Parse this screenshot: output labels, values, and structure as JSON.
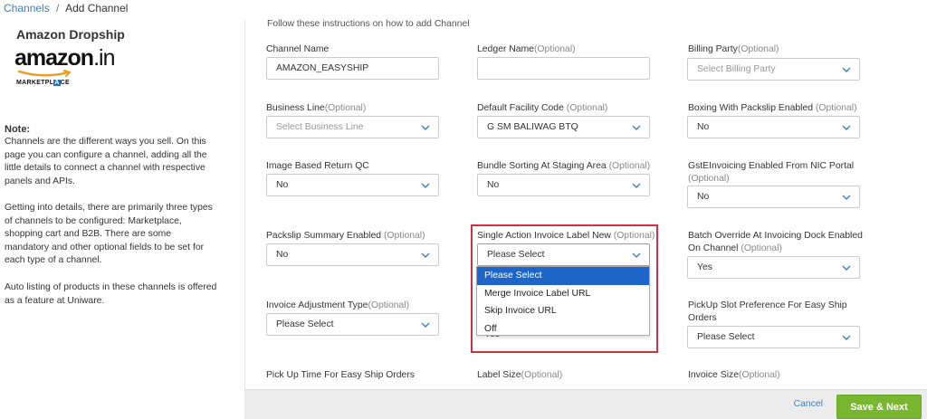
{
  "breadcrumb": {
    "parent": "Channels",
    "separator": "/",
    "current": "Add Channel"
  },
  "channel": {
    "title": "Amazon Dropship",
    "logo": {
      "main": "amazon",
      "suffix": ".in",
      "sub_before": "MARKETPL",
      "sub_highlight": "A",
      "sub_after": "CE"
    }
  },
  "note": {
    "title": "Note:",
    "paragraphs": [
      "Channels are the different ways you sell. On this page you can configure a channel, adding all the little details to connect a channel with respective panels and APIs.",
      "Getting into details, there are primarily three types of channels to be configured: Marketplace, shopping cart and B2B. There are some mandatory and other optional fields to be set for each type of a channel.",
      "Auto listing of products in these channels is offered as a feature at Uniware."
    ]
  },
  "instructions": "Follow these instructions on how to add Channel",
  "fields": {
    "channel_name": {
      "label": "Channel Name",
      "optional": "",
      "value": "AMAZON_EASYSHIP"
    },
    "ledger_name": {
      "label": "Ledger Name",
      "optional": "(Optional)",
      "value": ""
    },
    "billing_party": {
      "label": "Billing Party",
      "optional": "(Optional)",
      "value": "Select Billing Party"
    },
    "business_line": {
      "label": "Business Line",
      "optional": "(Optional)",
      "value": "Select Business Line"
    },
    "default_facility": {
      "label": "Default Facility Code",
      "optional": " (Optional)",
      "value": "G SM BALIWAG BTQ"
    },
    "boxing_packslip": {
      "label": "Boxing With Packslip Enabled",
      "optional": " (Optional)",
      "value": "No"
    },
    "image_return_qc": {
      "label": "Image Based Return QC",
      "optional": "",
      "value": "No"
    },
    "bundle_sorting": {
      "label": "Bundle Sorting At Staging Area",
      "optional": " (Optional)",
      "value": "No"
    },
    "gst_einvoicing": {
      "label": "GstEInvoicing Enabled From NIC Portal",
      "optional": "(Optional)",
      "value": "No"
    },
    "packslip_summary": {
      "label": "Packslip Summary Enabled",
      "optional": " (Optional)",
      "value": "No"
    },
    "single_action_invoice": {
      "label": "Single Action Invoice Label New",
      "optional": " (Optional)",
      "value": "Please Select"
    },
    "batch_override": {
      "label": "Batch Override At Invoicing Dock Enabled",
      "label_line2": "On Channel",
      "optional": " (Optional)",
      "value": "Yes"
    },
    "invoice_adjustment": {
      "label": "Invoice Adjustment Type",
      "optional": "(Optional)",
      "value": "Please Select"
    },
    "pickup_slot": {
      "label": "PickUp Slot Preference For Easy Ship",
      "label_line2": "Orders",
      "optional": "",
      "value": "Please Select"
    },
    "pickup_time": {
      "label": "Pick Up Time For Easy Ship Orders",
      "optional": ""
    },
    "label_size": {
      "label": "Label Size",
      "optional": "(Optional)"
    },
    "invoice_size": {
      "label": "Invoice Size",
      "optional": "(Optional)"
    }
  },
  "dropdown": {
    "options": [
      "Please Select",
      "Merge Invoice Label URL",
      "Skip Invoice URL",
      "Off"
    ],
    "selected_index": 0,
    "behind_value": "Yes"
  },
  "footer": {
    "cancel_label": "Cancel",
    "save_label": "Save & Next"
  },
  "colors": {
    "link": "#3d7fc1",
    "highlight_border": "#d32f3f",
    "selected_option": "#1e65c9",
    "save_button": "#7ab730"
  }
}
